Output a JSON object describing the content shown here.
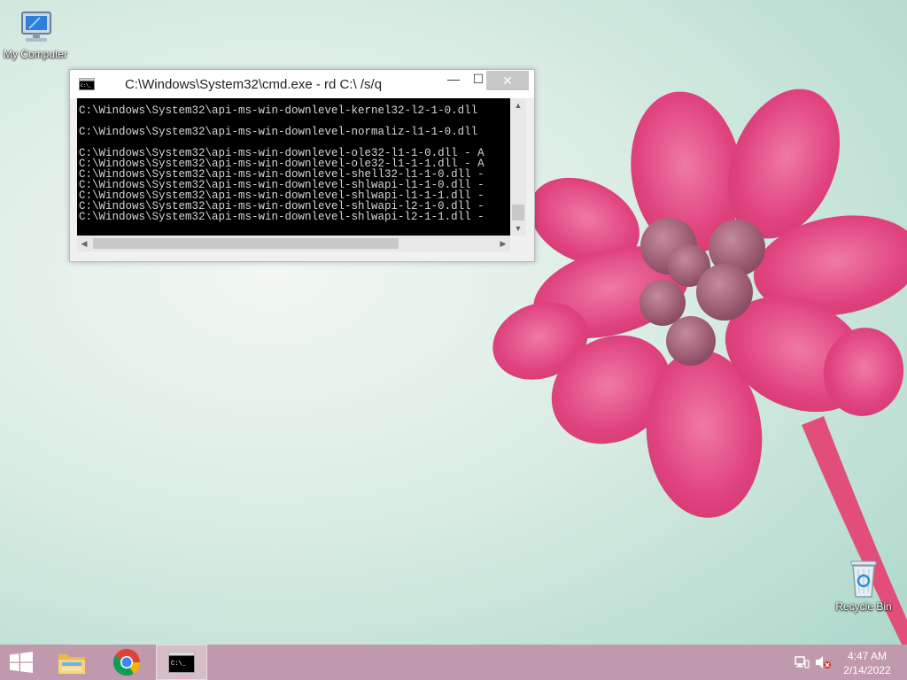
{
  "desktop": {
    "icons": [
      {
        "label": "My Computer",
        "icon": "computer-icon"
      },
      {
        "label": "Recycle Bin",
        "icon": "recycle-bin-icon"
      }
    ]
  },
  "window": {
    "title": "C:\\Windows\\System32\\cmd.exe - rd  C:\\ /s/q",
    "controls": {
      "minimize": "—",
      "maximize": "☐",
      "close": "✕"
    },
    "console_lines": [
      "C:\\Windows\\System32\\api-ms-win-downlevel-kernel32-l2-1-0.dll",
      "",
      "C:\\Windows\\System32\\api-ms-win-downlevel-normaliz-l1-1-0.dll",
      "",
      "C:\\Windows\\System32\\api-ms-win-downlevel-ole32-l1-1-0.dll - A",
      "C:\\Windows\\System32\\api-ms-win-downlevel-ole32-l1-1-1.dll - A",
      "C:\\Windows\\System32\\api-ms-win-downlevel-shell32-l1-1-0.dll -",
      "C:\\Windows\\System32\\api-ms-win-downlevel-shlwapi-l1-1-0.dll -",
      "C:\\Windows\\System32\\api-ms-win-downlevel-shlwapi-l1-1-1.dll -",
      "C:\\Windows\\System32\\api-ms-win-downlevel-shlwapi-l2-1-0.dll -",
      "C:\\Windows\\System32\\api-ms-win-downlevel-shlwapi-l2-1-1.dll -"
    ]
  },
  "taskbar": {
    "items": [
      "start-button",
      "file-explorer",
      "chrome",
      "command-prompt"
    ],
    "clock": {
      "time": "4:47 AM",
      "date": "2/14/2022"
    }
  },
  "colors": {
    "taskbar": "#c09aac",
    "flower": "#e0447f",
    "console_bg": "#000000"
  }
}
